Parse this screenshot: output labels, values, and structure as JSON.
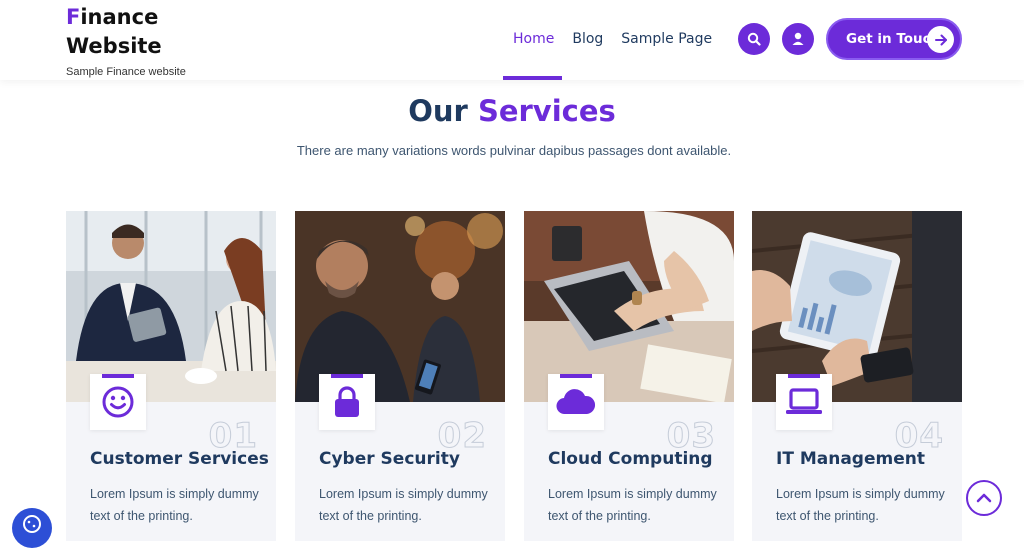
{
  "brand": {
    "logo_first": "F",
    "logo_rest": "inance Website",
    "tagline": "Sample Finance website",
    "accent": "#6c2bd9",
    "navy": "#1f3a5f"
  },
  "nav": {
    "items": [
      {
        "label": "Home",
        "active": true
      },
      {
        "label": "Blog"
      },
      {
        "label": "Sample Page"
      }
    ]
  },
  "header_actions": {
    "search_icon": "search-icon",
    "user_icon": "user-icon",
    "cta_label": "Get in Touch",
    "cta_icon": "arrow-right-icon"
  },
  "services": {
    "title_plain": "Our ",
    "title_accent": "Services",
    "subtitle": "There are many variations words pulvinar dapibus passages dont available.",
    "cards": [
      {
        "num": "01",
        "title": "Customer Services",
        "icon": "smiley-icon",
        "desc": "Lorem Ipsum is simply dummy text of the printing."
      },
      {
        "num": "02",
        "title": "Cyber Security",
        "icon": "lock-icon",
        "desc": "Lorem Ipsum is simply dummy text of the printing."
      },
      {
        "num": "03",
        "title": "Cloud Computing",
        "icon": "cloud-icon",
        "desc": "Lorem Ipsum is simply dummy text of the printing."
      },
      {
        "num": "04",
        "title": "IT Management",
        "icon": "laptop-icon",
        "desc": "Lorem Ipsum is simply dummy text of the printing."
      }
    ]
  },
  "floating": {
    "scroll_top_icon": "chevron-up-icon",
    "cookie_icon": "cookie-icon"
  }
}
